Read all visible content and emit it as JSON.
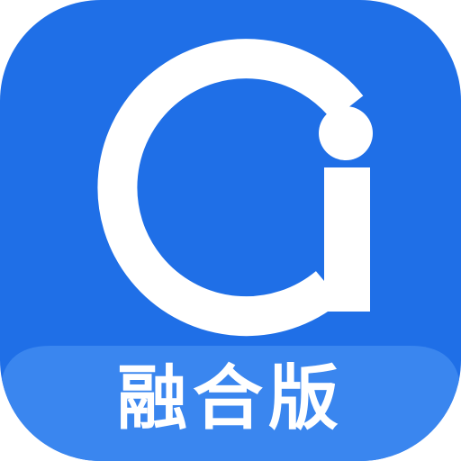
{
  "icon": {
    "background_color": "#1F6FE7",
    "band_color": "#3A86EF",
    "glyph_color": "#FFFFFF",
    "logo_icon": "ai-letter-logo-icon"
  },
  "band": {
    "label": "融合版"
  }
}
